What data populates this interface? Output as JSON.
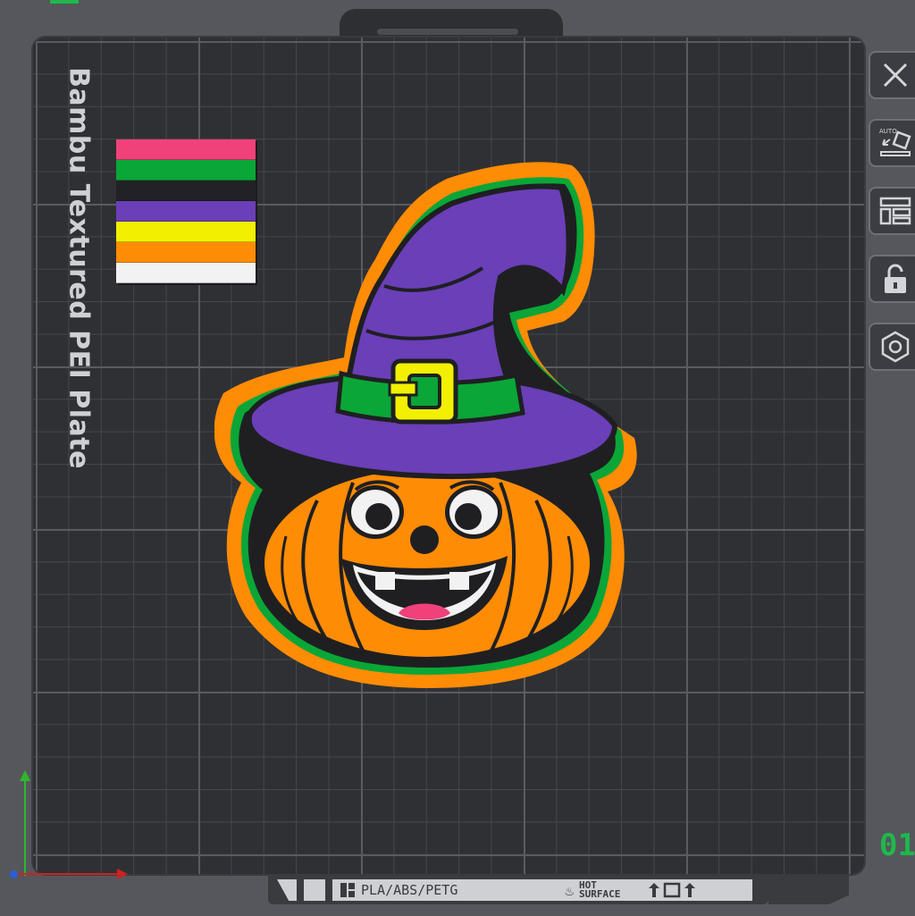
{
  "plate": {
    "label": "Bambu Textured PEI Plate",
    "number": "01"
  },
  "filament_swatches": [
    "#f0417a",
    "#0aa637",
    "#222226",
    "#6a3fb8",
    "#f2f000",
    "#ff8c05",
    "#f2f2f2"
  ],
  "toolbar": {
    "buttons": [
      {
        "name": "close",
        "icon": "close-icon"
      },
      {
        "name": "auto-orient",
        "icon": "auto-orient-icon",
        "label": "AUTO"
      },
      {
        "name": "arrange",
        "icon": "arrange-icon"
      },
      {
        "name": "lock",
        "icon": "lock-icon"
      },
      {
        "name": "settings",
        "icon": "hex-nut-icon"
      }
    ]
  },
  "bottom_bar": {
    "material": "PLA/ABS/PETG",
    "hot_line1": "HOT",
    "hot_line2": "SURFACE"
  },
  "colors": {
    "plate": "#2f3034",
    "background": "#55575c",
    "accent_green": "#1fb84c",
    "pumpkin_orange": "#ff8c05",
    "hat_purple": "#6a3fb8"
  }
}
